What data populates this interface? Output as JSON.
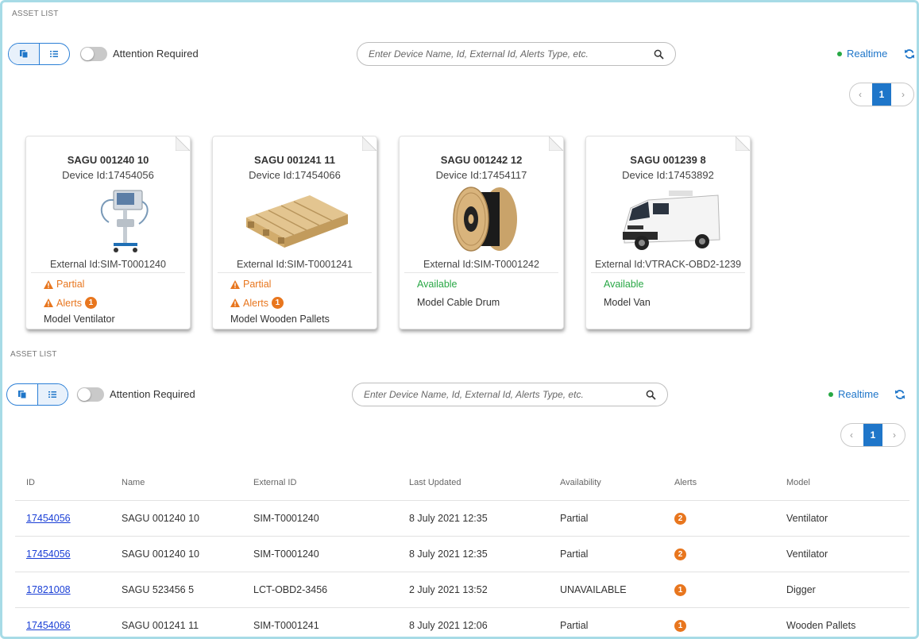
{
  "section_title": "ASSET LIST",
  "toolbar": {
    "attention_label": "Attention Required",
    "search_placeholder": "Enter Device Name, Id, External Id, Alerts Type, etc.",
    "realtime_label": "Realtime",
    "current_page": "1"
  },
  "cards": [
    {
      "name": "SAGU 001240 10",
      "device_id": "Device Id:17454056",
      "external_id": "External Id:SIM-T0001240",
      "status": "Partial",
      "status_type": "partial",
      "alerts_label": "Alerts",
      "alerts_count": "1",
      "model": "Model Ventilator",
      "image": "ventilator"
    },
    {
      "name": "SAGU 001241 11",
      "device_id": "Device Id:17454066",
      "external_id": "External Id:SIM-T0001241",
      "status": "Partial",
      "status_type": "partial",
      "alerts_label": "Alerts",
      "alerts_count": "1",
      "model": "Model Wooden Pallets",
      "image": "wooden-pallet"
    },
    {
      "name": "SAGU 001242 12",
      "device_id": "Device Id:17454117",
      "external_id": "External Id:SIM-T0001242",
      "status": "Available",
      "status_type": "available",
      "model": "Model Cable Drum",
      "image": "cable-drum"
    },
    {
      "name": "SAGU 001239 8",
      "device_id": "Device Id:17453892",
      "external_id": "External Id:VTRACK-OBD2-1239",
      "status": "Available",
      "status_type": "available",
      "model": "Model Van",
      "image": "van"
    }
  ],
  "table": {
    "headers": [
      "ID",
      "Name",
      "External ID",
      "Last Updated",
      "Availability",
      "Alerts",
      "Model"
    ],
    "rows": [
      {
        "id": "17454056",
        "name": "SAGU 001240 10",
        "external_id": "SIM-T0001240",
        "last_updated": "8 July 2021 12:35",
        "availability": "Partial",
        "alerts": "2",
        "model": "Ventilator"
      },
      {
        "id": "17454056",
        "name": "SAGU 001240 10",
        "external_id": "SIM-T0001240",
        "last_updated": "8 July 2021 12:35",
        "availability": "Partial",
        "alerts": "2",
        "model": "Ventilator"
      },
      {
        "id": "17821008",
        "name": "SAGU 523456 5",
        "external_id": "LCT-OBD2-3456",
        "last_updated": "2 July 2021 13:52",
        "availability": "UNAVAILABLE",
        "alerts": "1",
        "model": "Digger"
      },
      {
        "id": "17454066",
        "name": "SAGU 001241 11",
        "external_id": "SIM-T0001241",
        "last_updated": "8 July 2021 12:06",
        "availability": "Partial",
        "alerts": "1",
        "model": "Wooden Pallets"
      }
    ]
  },
  "colors": {
    "frame_border": "#a7dbe6",
    "accent_blue": "#1f76c9",
    "warning_orange": "#e8761e",
    "available_green": "#28a745",
    "link_blue": "#1a3fd6"
  }
}
